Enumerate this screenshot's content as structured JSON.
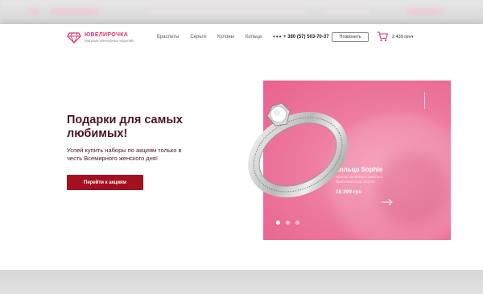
{
  "header": {
    "logo": {
      "name": "ЮВЕЛИРОЧКА",
      "tagline": "Магазин ювелирных изделий"
    },
    "nav": [
      {
        "label": "Браслеты"
      },
      {
        "label": "Серьги"
      },
      {
        "label": "Кулоны"
      },
      {
        "label": "Кольца"
      }
    ],
    "more_label": "•••",
    "phone": "+ 380 (57) 503-70-37",
    "call_button": "Позвонить",
    "cart_total": "2 439 грн",
    "cart_chevron": "▾"
  },
  "hero": {
    "title": "Подарки для самых любимых!",
    "subtitle": "Успей купить наборы по акциям только в честь Всемирного женского дня!",
    "cta_label": "Перейти к акциям"
  },
  "slide": {
    "title": "Кольцо Sophie",
    "description": "Кольцо из белого золота с бриллиантами Sophie",
    "price": "16 399 грн",
    "dots_total": 3,
    "active_dot": 1
  },
  "colors": {
    "brand": "#e0306b",
    "cta": "#a3111f",
    "heading": "#4a1428",
    "card": "#ee7ca0"
  },
  "icons": [
    "diamond-logo-icon",
    "more-dots-icon",
    "cart-icon",
    "chevron-down-icon",
    "arrow-right-icon",
    "ring-image"
  ]
}
